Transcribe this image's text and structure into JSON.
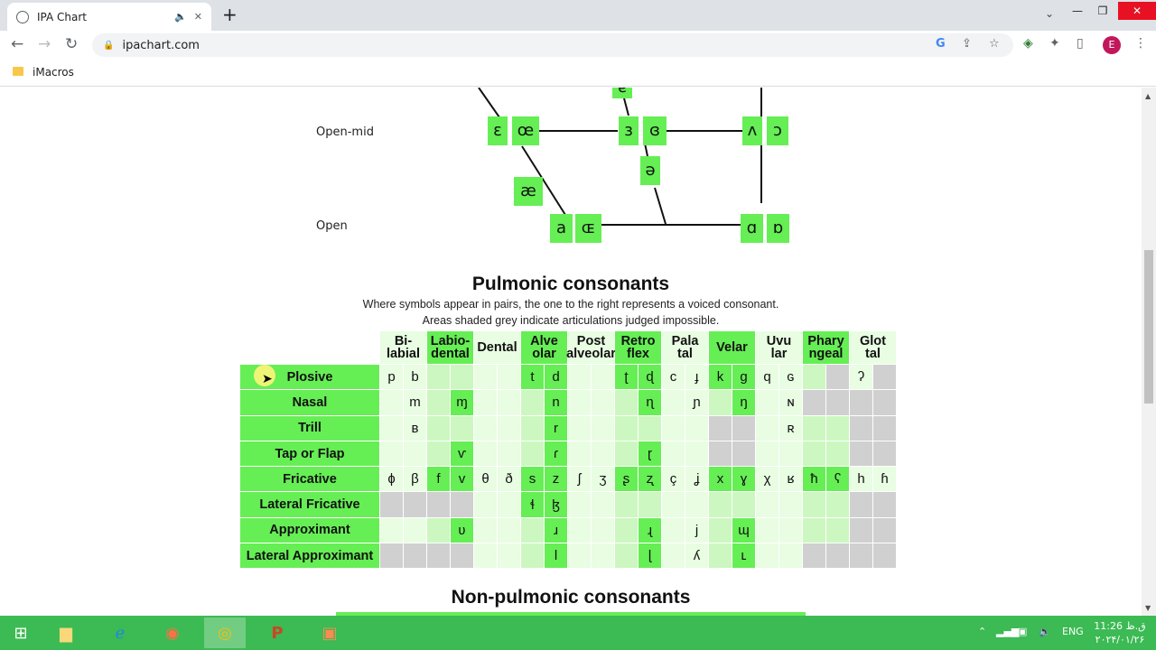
{
  "browser": {
    "tab_title": "IPA Chart",
    "url": "ipachart.com",
    "bookmark": "iMacros",
    "profile_initial": "E"
  },
  "vowels": {
    "rows": [
      {
        "label": "Open-mid",
        "symbols": [
          "ɛ",
          "œ",
          "ɜ",
          "ɞ",
          "ʌ",
          "ɔ"
        ]
      },
      {
        "label": "Open",
        "symbols": [
          "a",
          "ɶ",
          "ɑ",
          "ɒ"
        ]
      }
    ],
    "extra": [
      "ɐ",
      "æ",
      "ə"
    ]
  },
  "pulmonic": {
    "title": "Pulmonic consonants",
    "note1": "Where symbols appear in pairs, the one to the right represents a voiced consonant.",
    "note2": "Areas shaded grey indicate articulations judged impossible.",
    "columns": [
      {
        "label": "Bi-\nlabial",
        "shade": "light"
      },
      {
        "label": "Labio-\ndental",
        "shade": "sym"
      },
      {
        "label": "Dental",
        "shade": "light"
      },
      {
        "label": "Alve\nolar",
        "shade": "sym"
      },
      {
        "label": "Post\nalveolar",
        "shade": "light"
      },
      {
        "label": "Retro\nflex",
        "shade": "sym"
      },
      {
        "label": "Pala\ntal",
        "shade": "light"
      },
      {
        "label": "Velar",
        "shade": "sym"
      },
      {
        "label": "Uvu\nlar",
        "shade": "light"
      },
      {
        "label": "Phary\nngeal",
        "shade": "sym"
      },
      {
        "label": "Glot\ntal",
        "shade": "light"
      }
    ],
    "rows": [
      {
        "label": "Plosive",
        "cells": [
          "p",
          "b",
          "",
          "",
          "",
          "",
          "t",
          "d",
          "",
          "",
          "ʈ",
          "ɖ",
          "c",
          "ɟ",
          "k",
          "ɡ",
          "q",
          "ɢ",
          "",
          "#",
          "ʔ",
          "#"
        ]
      },
      {
        "label": "Nasal",
        "cells": [
          "",
          "m",
          "",
          "ɱ",
          "",
          "",
          "",
          "n",
          "",
          "",
          "",
          "ɳ",
          "",
          "ɲ",
          "",
          "ŋ",
          "",
          "ɴ",
          "#",
          "#",
          "#",
          "#"
        ]
      },
      {
        "label": "Trill",
        "cells": [
          "",
          "ʙ",
          "",
          "",
          "",
          "",
          "",
          "r",
          "",
          "",
          "",
          "",
          "",
          "",
          "#",
          "#",
          "",
          "ʀ",
          "",
          "",
          "#",
          "#"
        ]
      },
      {
        "label": "Tap or Flap",
        "cells": [
          "",
          "",
          "",
          "ⱱ",
          "",
          "",
          "",
          "ɾ",
          "",
          "",
          "",
          "ɽ",
          "",
          "",
          "#",
          "#",
          "",
          "",
          "",
          "",
          "#",
          "#"
        ]
      },
      {
        "label": "Fricative",
        "cells": [
          "ɸ",
          "β",
          "f",
          "v",
          "θ",
          "ð",
          "s",
          "z",
          "ʃ",
          "ʒ",
          "ʂ",
          "ʐ",
          "ç",
          "ʝ",
          "x",
          "ɣ",
          "χ",
          "ʁ",
          "ħ",
          "ʕ",
          "h",
          "ɦ"
        ]
      },
      {
        "label": "Lateral Fricative",
        "cells": [
          "#",
          "#",
          "#",
          "#",
          "",
          "",
          "ɬ",
          "ɮ",
          "",
          "",
          "",
          "",
          "",
          "",
          "",
          "",
          "",
          "",
          "",
          "",
          "#",
          "#"
        ]
      },
      {
        "label": "Approximant",
        "cells": [
          "",
          "",
          "",
          "ʋ",
          "",
          "",
          "",
          "ɹ",
          "",
          "",
          "",
          "ɻ",
          "",
          "j",
          "",
          "ɰ",
          "",
          "",
          "",
          "",
          "#",
          "#"
        ]
      },
      {
        "label": "Lateral Approximant",
        "cells": [
          "#",
          "#",
          "#",
          "#",
          "",
          "",
          "",
          "l",
          "",
          "",
          "",
          "ɭ",
          "",
          "ʎ",
          "",
          "ʟ",
          "",
          "",
          "#",
          "#",
          "#",
          "#"
        ]
      }
    ]
  },
  "nonpulmonic": {
    "title": "Non-pulmonic consonants"
  },
  "taskbar": {
    "lang": "ENG",
    "time": "11:26 ق.ظ",
    "date": "۲۰۲۴/۰۱/۲۶"
  }
}
